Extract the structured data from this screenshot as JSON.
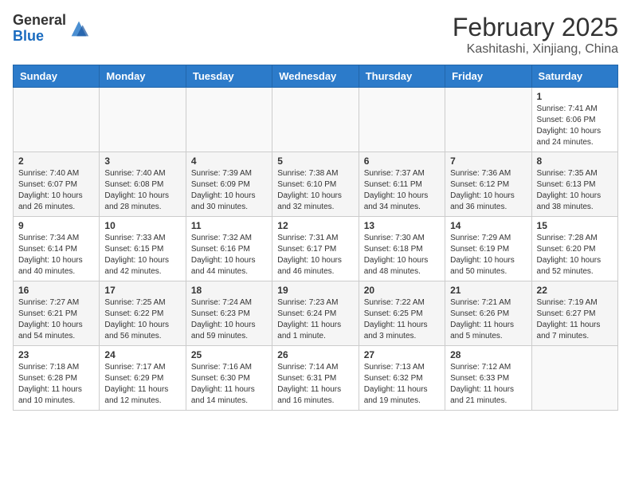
{
  "header": {
    "logo_line1": "General",
    "logo_line2": "Blue",
    "month": "February 2025",
    "location": "Kashitashi, Xinjiang, China"
  },
  "weekdays": [
    "Sunday",
    "Monday",
    "Tuesday",
    "Wednesday",
    "Thursday",
    "Friday",
    "Saturday"
  ],
  "weeks": [
    [
      {
        "day": "",
        "info": ""
      },
      {
        "day": "",
        "info": ""
      },
      {
        "day": "",
        "info": ""
      },
      {
        "day": "",
        "info": ""
      },
      {
        "day": "",
        "info": ""
      },
      {
        "day": "",
        "info": ""
      },
      {
        "day": "1",
        "info": "Sunrise: 7:41 AM\nSunset: 6:06 PM\nDaylight: 10 hours and 24 minutes."
      }
    ],
    [
      {
        "day": "2",
        "info": "Sunrise: 7:40 AM\nSunset: 6:07 PM\nDaylight: 10 hours and 26 minutes."
      },
      {
        "day": "3",
        "info": "Sunrise: 7:40 AM\nSunset: 6:08 PM\nDaylight: 10 hours and 28 minutes."
      },
      {
        "day": "4",
        "info": "Sunrise: 7:39 AM\nSunset: 6:09 PM\nDaylight: 10 hours and 30 minutes."
      },
      {
        "day": "5",
        "info": "Sunrise: 7:38 AM\nSunset: 6:10 PM\nDaylight: 10 hours and 32 minutes."
      },
      {
        "day": "6",
        "info": "Sunrise: 7:37 AM\nSunset: 6:11 PM\nDaylight: 10 hours and 34 minutes."
      },
      {
        "day": "7",
        "info": "Sunrise: 7:36 AM\nSunset: 6:12 PM\nDaylight: 10 hours and 36 minutes."
      },
      {
        "day": "8",
        "info": "Sunrise: 7:35 AM\nSunset: 6:13 PM\nDaylight: 10 hours and 38 minutes."
      }
    ],
    [
      {
        "day": "9",
        "info": "Sunrise: 7:34 AM\nSunset: 6:14 PM\nDaylight: 10 hours and 40 minutes."
      },
      {
        "day": "10",
        "info": "Sunrise: 7:33 AM\nSunset: 6:15 PM\nDaylight: 10 hours and 42 minutes."
      },
      {
        "day": "11",
        "info": "Sunrise: 7:32 AM\nSunset: 6:16 PM\nDaylight: 10 hours and 44 minutes."
      },
      {
        "day": "12",
        "info": "Sunrise: 7:31 AM\nSunset: 6:17 PM\nDaylight: 10 hours and 46 minutes."
      },
      {
        "day": "13",
        "info": "Sunrise: 7:30 AM\nSunset: 6:18 PM\nDaylight: 10 hours and 48 minutes."
      },
      {
        "day": "14",
        "info": "Sunrise: 7:29 AM\nSunset: 6:19 PM\nDaylight: 10 hours and 50 minutes."
      },
      {
        "day": "15",
        "info": "Sunrise: 7:28 AM\nSunset: 6:20 PM\nDaylight: 10 hours and 52 minutes."
      }
    ],
    [
      {
        "day": "16",
        "info": "Sunrise: 7:27 AM\nSunset: 6:21 PM\nDaylight: 10 hours and 54 minutes."
      },
      {
        "day": "17",
        "info": "Sunrise: 7:25 AM\nSunset: 6:22 PM\nDaylight: 10 hours and 56 minutes."
      },
      {
        "day": "18",
        "info": "Sunrise: 7:24 AM\nSunset: 6:23 PM\nDaylight: 10 hours and 59 minutes."
      },
      {
        "day": "19",
        "info": "Sunrise: 7:23 AM\nSunset: 6:24 PM\nDaylight: 11 hours and 1 minute."
      },
      {
        "day": "20",
        "info": "Sunrise: 7:22 AM\nSunset: 6:25 PM\nDaylight: 11 hours and 3 minutes."
      },
      {
        "day": "21",
        "info": "Sunrise: 7:21 AM\nSunset: 6:26 PM\nDaylight: 11 hours and 5 minutes."
      },
      {
        "day": "22",
        "info": "Sunrise: 7:19 AM\nSunset: 6:27 PM\nDaylight: 11 hours and 7 minutes."
      }
    ],
    [
      {
        "day": "23",
        "info": "Sunrise: 7:18 AM\nSunset: 6:28 PM\nDaylight: 11 hours and 10 minutes."
      },
      {
        "day": "24",
        "info": "Sunrise: 7:17 AM\nSunset: 6:29 PM\nDaylight: 11 hours and 12 minutes."
      },
      {
        "day": "25",
        "info": "Sunrise: 7:16 AM\nSunset: 6:30 PM\nDaylight: 11 hours and 14 minutes."
      },
      {
        "day": "26",
        "info": "Sunrise: 7:14 AM\nSunset: 6:31 PM\nDaylight: 11 hours and 16 minutes."
      },
      {
        "day": "27",
        "info": "Sunrise: 7:13 AM\nSunset: 6:32 PM\nDaylight: 11 hours and 19 minutes."
      },
      {
        "day": "28",
        "info": "Sunrise: 7:12 AM\nSunset: 6:33 PM\nDaylight: 11 hours and 21 minutes."
      },
      {
        "day": "",
        "info": ""
      }
    ]
  ]
}
